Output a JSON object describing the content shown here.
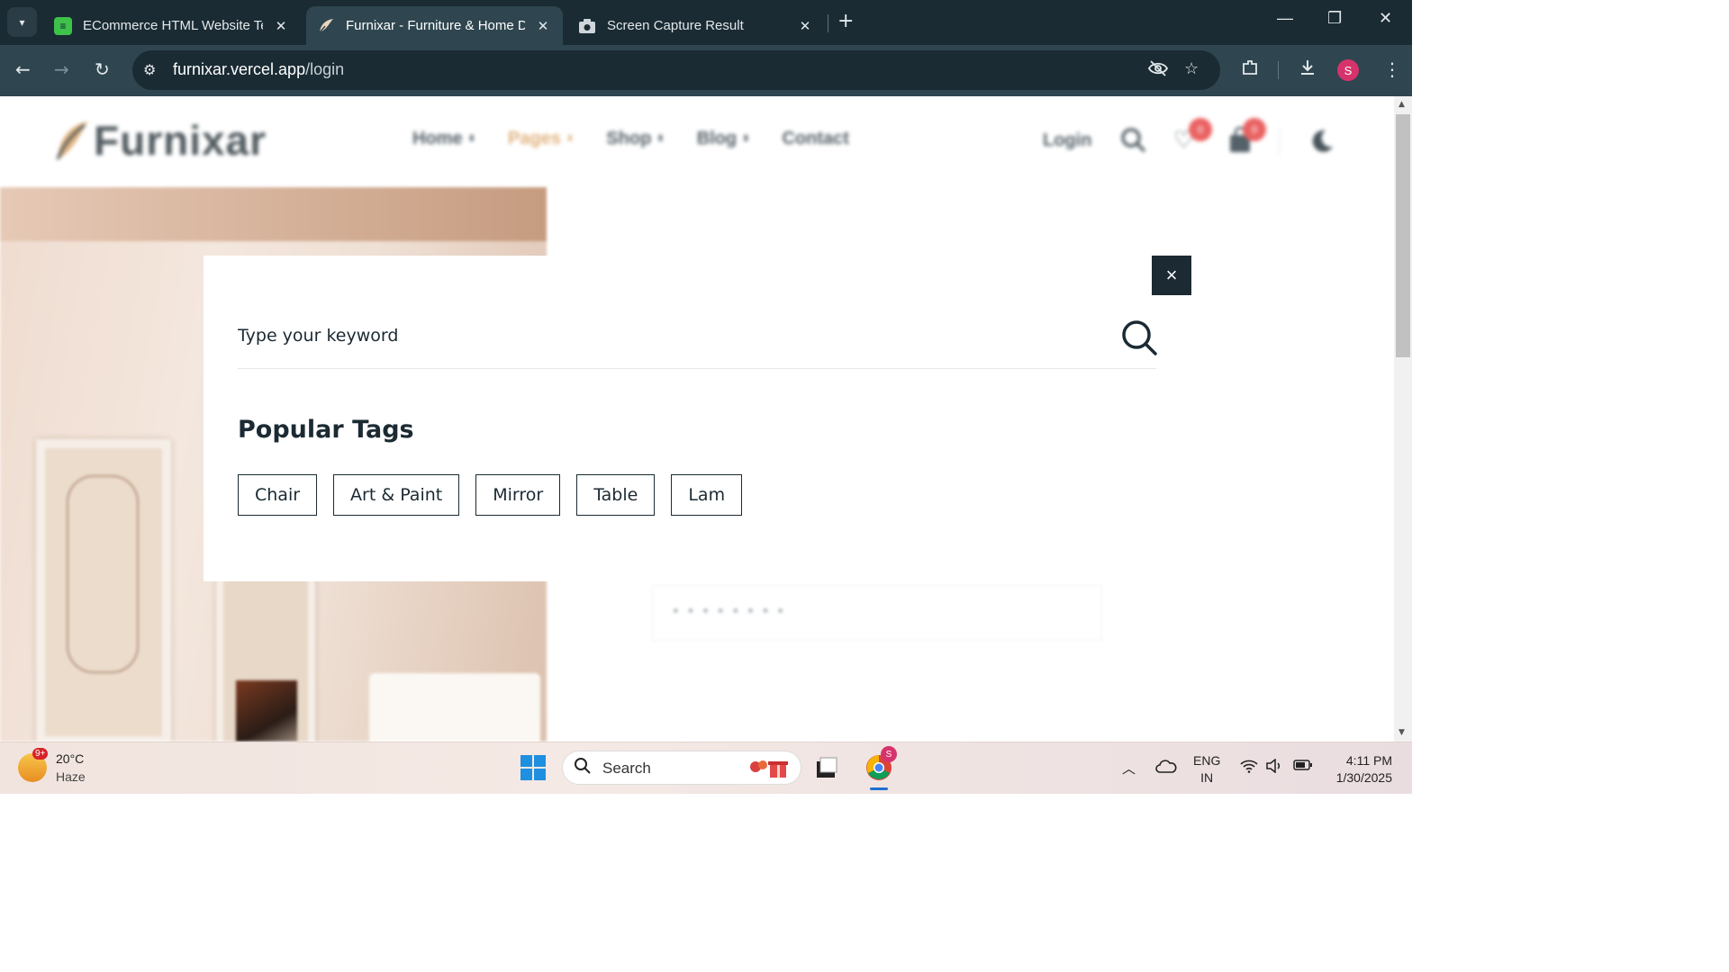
{
  "browser": {
    "tabs": [
      {
        "title": "ECommerce HTML Website Template",
        "icon": "green-doc-icon",
        "active": false
      },
      {
        "title": "Furnixar - Furniture & Home Decor",
        "icon": "furnixar-leaf-icon",
        "active": true
      },
      {
        "title": "Screen Capture Result",
        "icon": "camera-icon",
        "active": false
      }
    ],
    "url_host": "furnixar.vercel.app",
    "url_path": "/login",
    "profile_initial": "S"
  },
  "site": {
    "logo_text": "Furnixar",
    "menu": [
      {
        "label": "Home",
        "active": false
      },
      {
        "label": "Pages",
        "active": true
      },
      {
        "label": "Shop",
        "active": false
      },
      {
        "label": "Blog",
        "active": false
      },
      {
        "label": "Contact",
        "active": false
      }
    ],
    "login_label": "Login",
    "wishlist_count": "0",
    "cart_count": "0",
    "password_placeholder": "••••••••"
  },
  "search_modal": {
    "close_symbol": "×",
    "placeholder": "Type your keyword",
    "popular_title": "Popular Tags",
    "tags": [
      "Chair",
      "Art & Paint",
      "Mirror",
      "Table",
      "Lam"
    ]
  },
  "taskbar": {
    "weather_badge": "9+",
    "temperature": "20°C",
    "condition": "Haze",
    "search_label": "Search",
    "lang_line1": "ENG",
    "lang_line2": "IN",
    "time": "4:11 PM",
    "date": "1/30/2025",
    "chrome_badge": "S"
  },
  "colors": {
    "modal_dark": "#1b2a33",
    "accent_gold": "#d89f5e",
    "badge_red": "#e63b3b"
  }
}
